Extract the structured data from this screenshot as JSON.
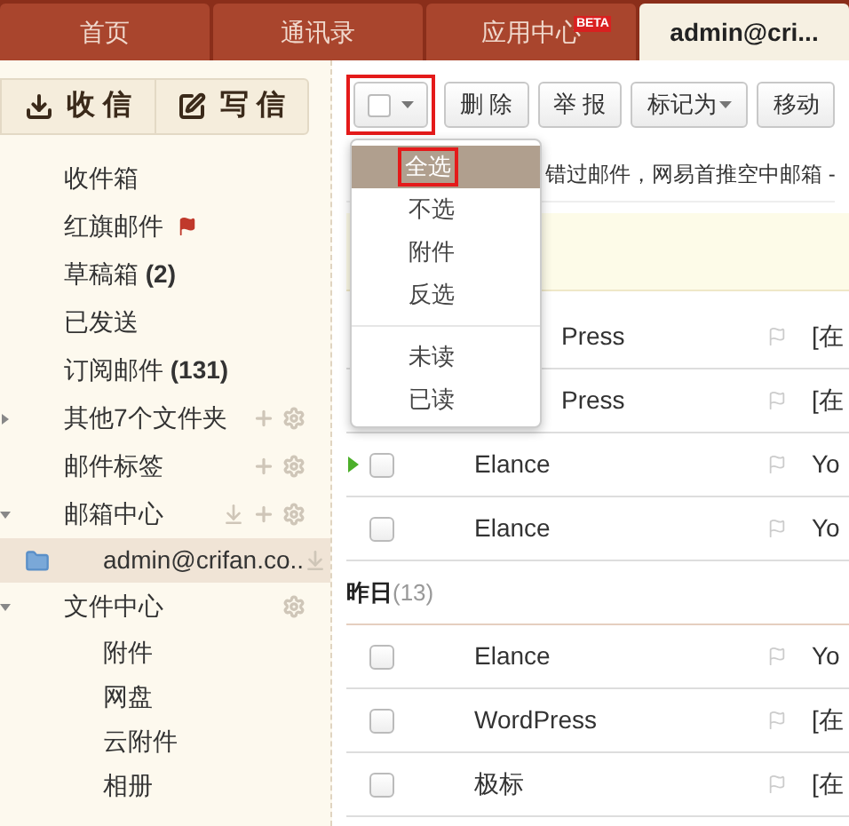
{
  "tabs": [
    {
      "label": "首页",
      "selected": false
    },
    {
      "label": "通讯录",
      "selected": false
    },
    {
      "label": "应用中心",
      "badge": "BETA",
      "selected": false
    },
    {
      "label": "admin@cri...",
      "selected": true
    }
  ],
  "sidebar": {
    "buttons": [
      {
        "kind": "receive",
        "label": "收 信"
      },
      {
        "kind": "compose",
        "label": "写 信"
      }
    ],
    "items": [
      {
        "label": "收件箱",
        "selected": false
      },
      {
        "label": "红旗邮件",
        "flag": true,
        "selected": false
      },
      {
        "label": "草稿箱 **(2)**",
        "selected": false
      },
      {
        "label": "已发送",
        "selected": false
      },
      {
        "label": "订阅邮件 **(131)**",
        "selected": false
      },
      {
        "label": "其他7个文件夹",
        "expanded": false,
        "add": true,
        "settings": true,
        "selected": false
      },
      {
        "label": "邮件标签",
        "add": true,
        "settings": true,
        "selected": false
      },
      {
        "label": "邮箱中心",
        "expanded": true,
        "download": true,
        "add": true,
        "settings": true,
        "selected": false,
        "children": [
          {
            "label": "admin@crifan.co..",
            "download": true,
            "selected": true
          }
        ]
      },
      {
        "label": "文件中心",
        "expanded": true,
        "settings": true,
        "selected": false,
        "children": [
          {
            "label": "附件",
            "selected": false
          },
          {
            "label": "网盘",
            "selected": false
          },
          {
            "label": "云附件",
            "selected": false
          },
          {
            "label": "相册",
            "selected": false
          }
        ]
      }
    ]
  },
  "toolbar": {
    "select_button": {
      "checked": false,
      "highlighted": true
    },
    "buttons": [
      {
        "label": "删 除"
      },
      {
        "label": "举 报"
      },
      {
        "label": "标记为",
        "dropdown": true
      },
      {
        "label": "移动"
      }
    ]
  },
  "notice": "错过邮件，网易首推空中邮箱 -",
  "select_menu": [
    {
      "label": "全选",
      "selected": true
    },
    {
      "label": "不选",
      "selected": false
    },
    {
      "label": "附件",
      "selected": false
    },
    {
      "label": "反选",
      "selected": false
    },
    {
      "label": "未读",
      "selected": false,
      "divider_before": true
    },
    {
      "label": "已读",
      "selected": false
    }
  ],
  "groups": [
    {
      "rows": [
        {
          "sender": "Press",
          "covered": true,
          "subject": "[在",
          "current": false
        },
        {
          "sender": "Press",
          "covered": true,
          "subject": "[在",
          "current": false
        },
        {
          "sender": "Elance",
          "covered": false,
          "subject": "Yo",
          "current": true,
          "checked": false
        },
        {
          "sender": "Elance",
          "covered": false,
          "subject": "Yo",
          "current": false,
          "checked": false
        }
      ]
    },
    {
      "title": "昨日",
      "count": "(13)",
      "rows": [
        {
          "sender": "Elance",
          "covered": false,
          "subject": "Yo",
          "current": false,
          "checked": false
        },
        {
          "sender": "WordPress",
          "covered": false,
          "subject": "[在",
          "current": false,
          "checked": false
        },
        {
          "sender": "极标",
          "covered": false,
          "subject": "[在",
          "current": false,
          "checked": false
        }
      ]
    }
  ]
}
